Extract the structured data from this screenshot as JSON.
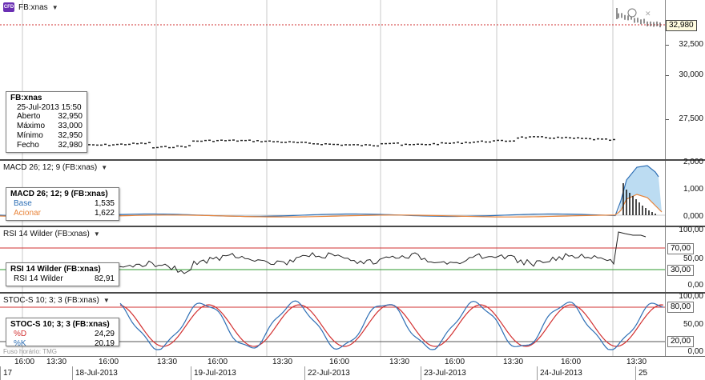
{
  "symbol": "FB:xnas",
  "price_pane": {
    "title": "FB:xnas",
    "last_price": "32,980",
    "y_ticks": [
      "32,500",
      "30,000",
      "27,500"
    ],
    "info": {
      "symbol": "FB:xnas",
      "datetime": "25-Jul-2013 15:50",
      "rows": [
        {
          "label": "Aberto",
          "value": "32,950"
        },
        {
          "label": "Máximo",
          "value": "33,000"
        },
        {
          "label": "Mínimo",
          "value": "32,950"
        },
        {
          "label": "Fecho",
          "value": "32,980"
        }
      ]
    }
  },
  "macd_pane": {
    "title": "MACD 26; 12; 9 (FB:xnas)",
    "y_ticks": [
      "2,000",
      "1,000",
      "0,000"
    ],
    "info": {
      "header": "MACD 26; 12; 9 (FB:xnas)",
      "rows": [
        {
          "label": "Base",
          "value": "1,535",
          "color": "#2e6fb5"
        },
        {
          "label": "Acionar",
          "value": "1,622",
          "color": "#e8843a"
        }
      ]
    }
  },
  "rsi_pane": {
    "title": "RSI 14 Wilder (FB:xnas)",
    "y_ticks": [
      "100,00",
      "70,00",
      "50,00",
      "30,00",
      "0,00"
    ],
    "level_tags": [
      "70,00",
      "30,00"
    ],
    "info": {
      "header": "RSI 14 Wilder (FB:xnas)",
      "rows": [
        {
          "label": "RSI 14 Wilder",
          "value": "82,91"
        }
      ]
    }
  },
  "stoch_pane": {
    "title": "STOC-S 10; 3; 3 (FB:xnas)",
    "y_ticks": [
      "100,00",
      "80,00",
      "50,00",
      "20,00",
      "0,00"
    ],
    "level_tags": [
      "80,00",
      "20,00"
    ],
    "info": {
      "header": "STOC-S 10; 3; 3 (FB:xnas)",
      "rows": [
        {
          "label": "%D",
          "value": "24,29",
          "color": "#d23030"
        },
        {
          "label": "%K",
          "value": "20,19",
          "color": "#2e6fb5"
        }
      ]
    },
    "timezone_note": "Fuso horário: TMG"
  },
  "time_axis": {
    "times": [
      "16:00",
      "13:30",
      "16:00",
      "13:30",
      "16:00",
      "13:30",
      "16:00",
      "13:30",
      "16:00",
      "13:30",
      "16:00",
      "13:30"
    ],
    "dates": [
      "17",
      "18-Jul-2013",
      "19-Jul-2013",
      "22-Jul-2013",
      "23-Jul-2013",
      "24-Jul-2013",
      "25"
    ]
  },
  "colors": {
    "macd_line": "#2e6fb5",
    "macd_signal": "#e8843a",
    "macd_fill": "#bcdcf2",
    "rsi_line": "#222222",
    "level_red": "#d23030",
    "level_green": "#2e9a2e",
    "stoch_k": "#2e6fb5",
    "stoch_d": "#d23030",
    "price_line": "#d23030"
  },
  "icons": [
    "cfd-icon",
    "caret-down-icon",
    "clock-icon",
    "close-icon"
  ]
}
